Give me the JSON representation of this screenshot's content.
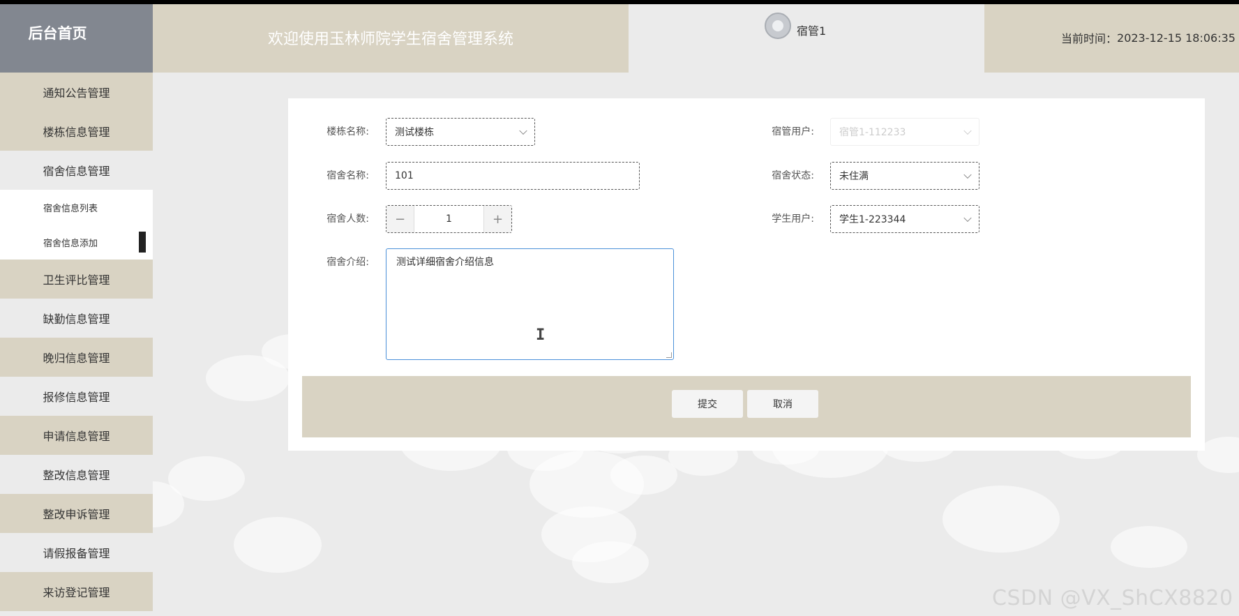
{
  "header": {
    "brand": "后台首页",
    "welcome": "欢迎使用玉林师院学生宿舍管理系统",
    "username": "宿管1",
    "time_label": "当前时间：",
    "time_value": "2023-12-15 18:06:35"
  },
  "sidebar": {
    "items": [
      {
        "label": "通知公告管理"
      },
      {
        "label": "楼栋信息管理"
      },
      {
        "label": "宿舍信息管理"
      },
      {
        "label": "卫生评比管理"
      },
      {
        "label": "缺勤信息管理"
      },
      {
        "label": "晚归信息管理"
      },
      {
        "label": "报修信息管理"
      },
      {
        "label": "申请信息管理"
      },
      {
        "label": "整改信息管理"
      },
      {
        "label": "整改申诉管理"
      },
      {
        "label": "请假报备管理"
      },
      {
        "label": "来访登记管理"
      }
    ],
    "subitems": [
      {
        "label": "宿舍信息列表"
      },
      {
        "label": "宿舍信息添加"
      }
    ]
  },
  "form": {
    "building": {
      "label": "楼栋名称:",
      "value": "测试楼栋"
    },
    "manager": {
      "label": "宿管用户:",
      "value": "宿管1-112233"
    },
    "room_name": {
      "label": "宿舍名称:",
      "value": "101"
    },
    "room_status": {
      "label": "宿舍状态:",
      "value": "未住满"
    },
    "occupancy": {
      "label": "宿舍人数:",
      "value": "1",
      "minus": "−",
      "plus": "+"
    },
    "student": {
      "label": "学生用户:",
      "value": "学生1-223344"
    },
    "intro": {
      "label": "宿舍介绍:",
      "value": "测试详细宿舍介绍信息"
    },
    "submit": "提交",
    "cancel": "取消"
  },
  "watermark": "CSDN @VX_ShCX8820",
  "colors": {
    "tan": "#d9d3c3",
    "brand_grey": "#828790",
    "focus_blue": "#4a90d9"
  }
}
